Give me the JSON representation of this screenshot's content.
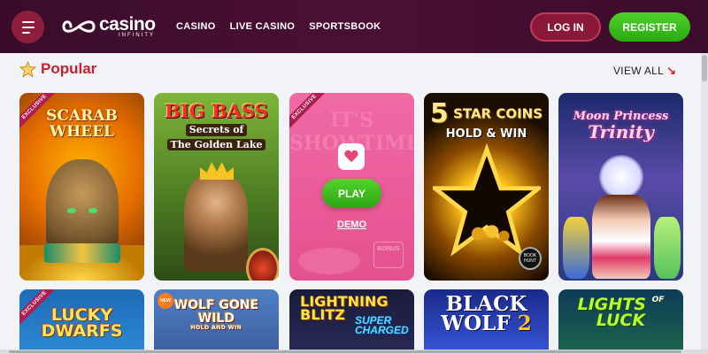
{
  "header": {
    "logo_main": "casino",
    "logo_sub": "INFINITY",
    "nav": [
      "CASINO",
      "LIVE CASINO",
      "SPORTSBOOK"
    ],
    "login_label": "LOG IN",
    "register_label": "REGISTER"
  },
  "section": {
    "title": "Popular",
    "view_all": "VIEW ALL",
    "view_all_arrow": "↘"
  },
  "tiles": [
    {
      "title_line1": "SCARAB",
      "title_line2": "WHEEL",
      "badge": "EXCLUSIVE"
    },
    {
      "title_line1": "BIG BASS",
      "title_line2": "Secrets of",
      "title_line3": "The Golden Lake"
    },
    {
      "bg_title": "IT'S SHOWTIME!",
      "badge": "EXCLUSIVE",
      "play_label": "PLAY",
      "demo_label": "DEMO",
      "corner": "BONUS"
    },
    {
      "title_num": "5",
      "title_line1": "STAR COINS",
      "title_line2": "HOLD & WIN",
      "corner": "BOOK HUNT"
    },
    {
      "title_line1": "Moon Princess",
      "title_line2": "Trinity"
    }
  ],
  "tiles_row2": [
    {
      "title_line1": "LUCKY",
      "title_line2": "DWARFS",
      "badge": "EXCLUSIVE"
    },
    {
      "title_line1": "WOLF GONE WILD",
      "title_line2": "HOLD AND WIN",
      "badge": "NEW"
    },
    {
      "title_line1": "LIGHTNING",
      "title_line2": "BLITZ",
      "title_line3": "SUPER",
      "title_line4": "CHARGED"
    },
    {
      "title_line1": "BLACK",
      "title_line2": "WOLF",
      "title_num": "2"
    },
    {
      "title_line1": "LIGHTS",
      "title_of": "OF",
      "title_line2": "LUCK"
    }
  ],
  "colors": {
    "header_bg": "#3a0c2a",
    "accent_red": "#c91f30",
    "register_green": "#3ec41e",
    "login_bg": "#8a1838"
  }
}
